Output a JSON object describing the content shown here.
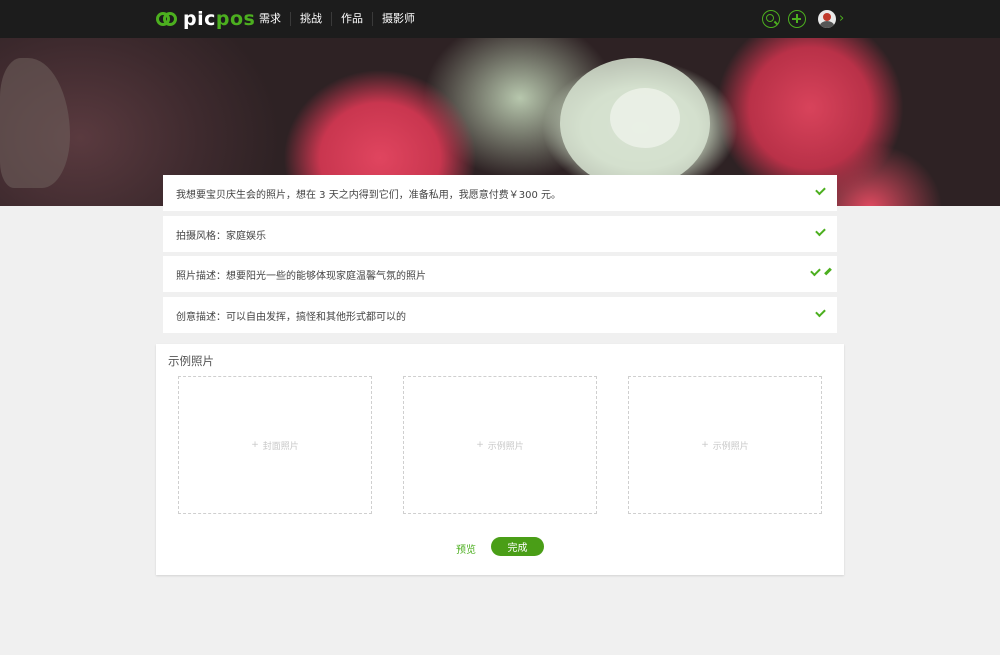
{
  "brand": {
    "logo_part1": "pic",
    "logo_part2": "pos"
  },
  "nav": {
    "items": [
      "需求",
      "挑战",
      "作品",
      "摄影师"
    ]
  },
  "colors": {
    "accent": "#4caf1f",
    "topbar": "#1c1c1c",
    "page_bg": "#f0f0f0",
    "done_button": "#4a9e17"
  },
  "icons": {
    "search": "search-icon",
    "add": "plus-icon",
    "profile": "avatar",
    "menu": "chevron-right-icon",
    "confirm": "check-icon",
    "edit": "pencil-icon"
  },
  "request": {
    "summary": "我想要宝贝庆生会的照片，想在 3 天之内得到它们，准备私用，我愿意付费￥300 元。",
    "style": "拍摄风格：家庭娱乐",
    "description": "照片描述：想要阳光一些的能够体现家庭温馨气氛的照片",
    "creative": "创意描述：可以自由发挥，搞怪和其他形式都可以的"
  },
  "samples": {
    "title": "示例照片",
    "plus": "+",
    "slots": [
      "封面照片",
      "示例照片",
      "示例照片"
    ]
  },
  "actions": {
    "preview": "预览",
    "done": "完成"
  }
}
